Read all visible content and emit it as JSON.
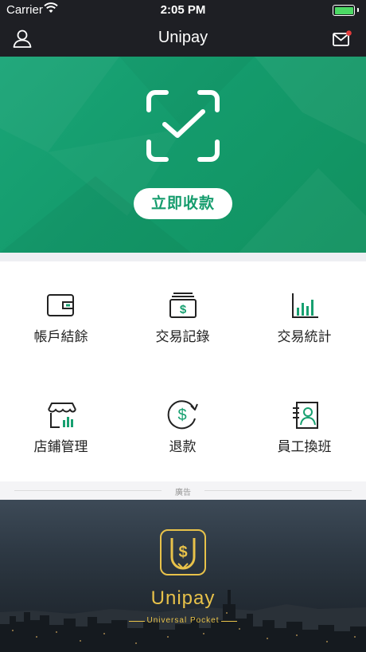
{
  "status_bar": {
    "carrier": "Carrier",
    "time": "2:05 PM"
  },
  "nav": {
    "title": "Unipay",
    "left_icon": "user-icon",
    "right_icon": "mail-icon",
    "has_notification_dot": true
  },
  "hero": {
    "button_label": "立即收款",
    "icon": "scan-check-icon",
    "color": "#17a070"
  },
  "menu": {
    "items": [
      {
        "label": "帳戶結餘",
        "icon": "wallet-icon"
      },
      {
        "label": "交易記錄",
        "icon": "cash-record-icon"
      },
      {
        "label": "交易統計",
        "icon": "bar-chart-icon"
      },
      {
        "label": "店鋪管理",
        "icon": "store-icon"
      },
      {
        "label": "退款",
        "icon": "refund-icon"
      },
      {
        "label": "員工換班",
        "icon": "staff-shift-icon"
      }
    ],
    "accent": "#17a070"
  },
  "ad": {
    "separator_label": "廣告",
    "brand": "Unipay",
    "tagline": "Universal Pocket",
    "brand_color": "#e8c24a"
  }
}
